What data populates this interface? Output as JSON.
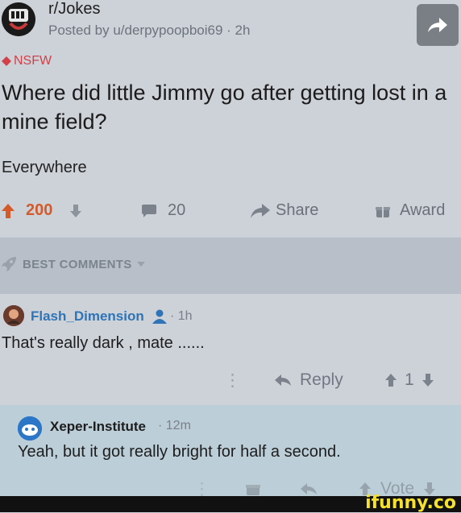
{
  "post": {
    "subreddit": "r/Jokes",
    "posted_by": "Posted by u/derpypoopboi69 · 2h",
    "nsfw_tag": "NSFW",
    "title": "Where did little Jimmy go after getting lost in a mine field?",
    "body": "Everywhere",
    "score": "200",
    "comments": "20",
    "share_label": "Share",
    "award_label": "Award"
  },
  "sort": {
    "label": "BEST COMMENTS"
  },
  "comments": [
    {
      "user": "Flash_Dimension",
      "time": "· 1h",
      "text": "That's really dark , mate ......",
      "reply_label": "Reply",
      "score": "1"
    },
    {
      "user": "Xeper-Institute",
      "time": "· 12m",
      "text": "Yeah, but it got really bright for half a second.",
      "vote_label": "Vote"
    }
  ],
  "watermark": "ifunny.co",
  "colors": {
    "upvote": "#d55a2a",
    "nsfw": "#d24149",
    "username": "#2f74b6",
    "watermark": "#f5e12d"
  }
}
